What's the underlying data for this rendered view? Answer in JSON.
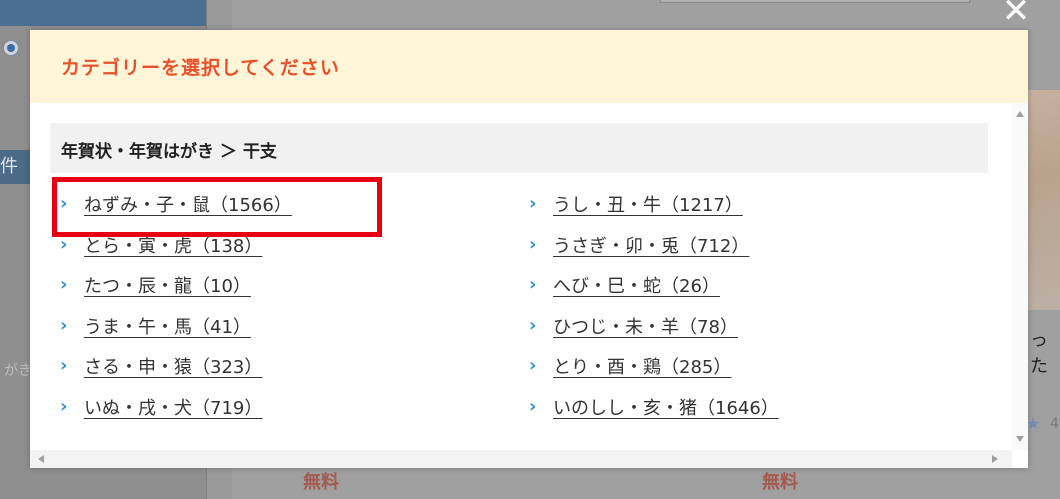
{
  "modal": {
    "title": "カテゴリーを選択してください",
    "breadcrumb": "年賀状・年賀はがき ＞ 干支",
    "close_icon": "close-icon",
    "left_items": [
      {
        "label": "ねずみ・子・鼠（1566）"
      },
      {
        "label": "とら・寅・虎（138）"
      },
      {
        "label": "たつ・辰・龍（10）"
      },
      {
        "label": "うま・午・馬（41）"
      },
      {
        "label": "さる・申・猿（323）"
      },
      {
        "label": "いぬ・戌・犬（719）"
      }
    ],
    "right_items": [
      {
        "label": "うし・丑・牛（1217）"
      },
      {
        "label": "うさぎ・卯・兎（712）"
      },
      {
        "label": "へび・巳・蛇（26）"
      },
      {
        "label": "ひつじ・未・羊（78）"
      },
      {
        "label": "とり・酉・鶏（285）"
      },
      {
        "label": "いのしし・亥・猪（1646）"
      }
    ]
  },
  "background": {
    "tag": "件",
    "gaki": "がき",
    "free_label_1": "無料",
    "free_label_2": "無料",
    "right_text": "った",
    "right_count": "4"
  },
  "colors": {
    "accent": "#e8512a",
    "link_chevron": "#2f93c8",
    "highlight": "#e60012",
    "header_bg": "#fff5d9"
  }
}
